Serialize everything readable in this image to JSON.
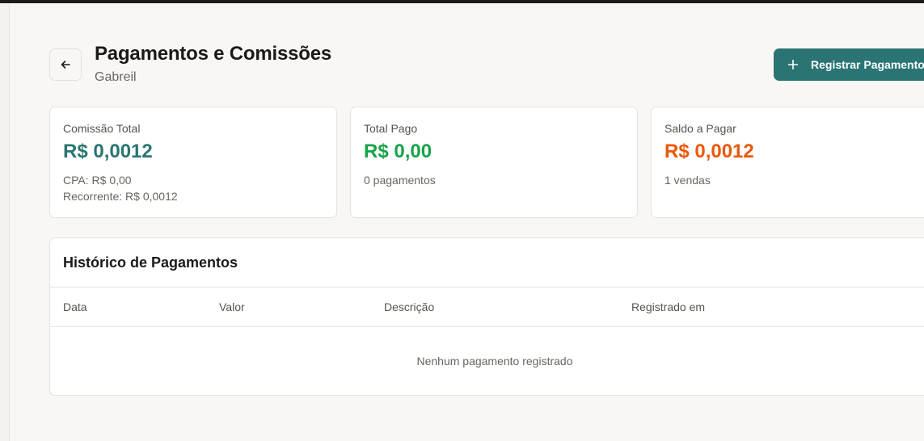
{
  "header": {
    "title": "Pagamentos e Comissões",
    "subtitle": "Gabreil",
    "register_button": "Registrar Pagamento"
  },
  "cards": [
    {
      "label": "Comissão Total",
      "value": "R$ 0,0012",
      "color": "#2a7573",
      "notes": [
        "CPA: R$ 0,00",
        "Recorrente: R$ 0,0012"
      ]
    },
    {
      "label": "Total Pago",
      "value": "R$ 0,00",
      "color": "#16a34a",
      "notes": [
        "0 pagamentos"
      ]
    },
    {
      "label": "Saldo a Pagar",
      "value": "R$ 0,0012",
      "color": "#ea580c",
      "notes": [
        "1 vendas"
      ]
    }
  ],
  "history": {
    "title": "Histórico de Pagamentos",
    "columns": [
      "Data",
      "Valor",
      "Descrição",
      "Registrado em"
    ],
    "empty_message": "Nenhum pagamento registrado"
  },
  "icons": {
    "back": "arrow-left-icon",
    "add": "plus-icon"
  }
}
